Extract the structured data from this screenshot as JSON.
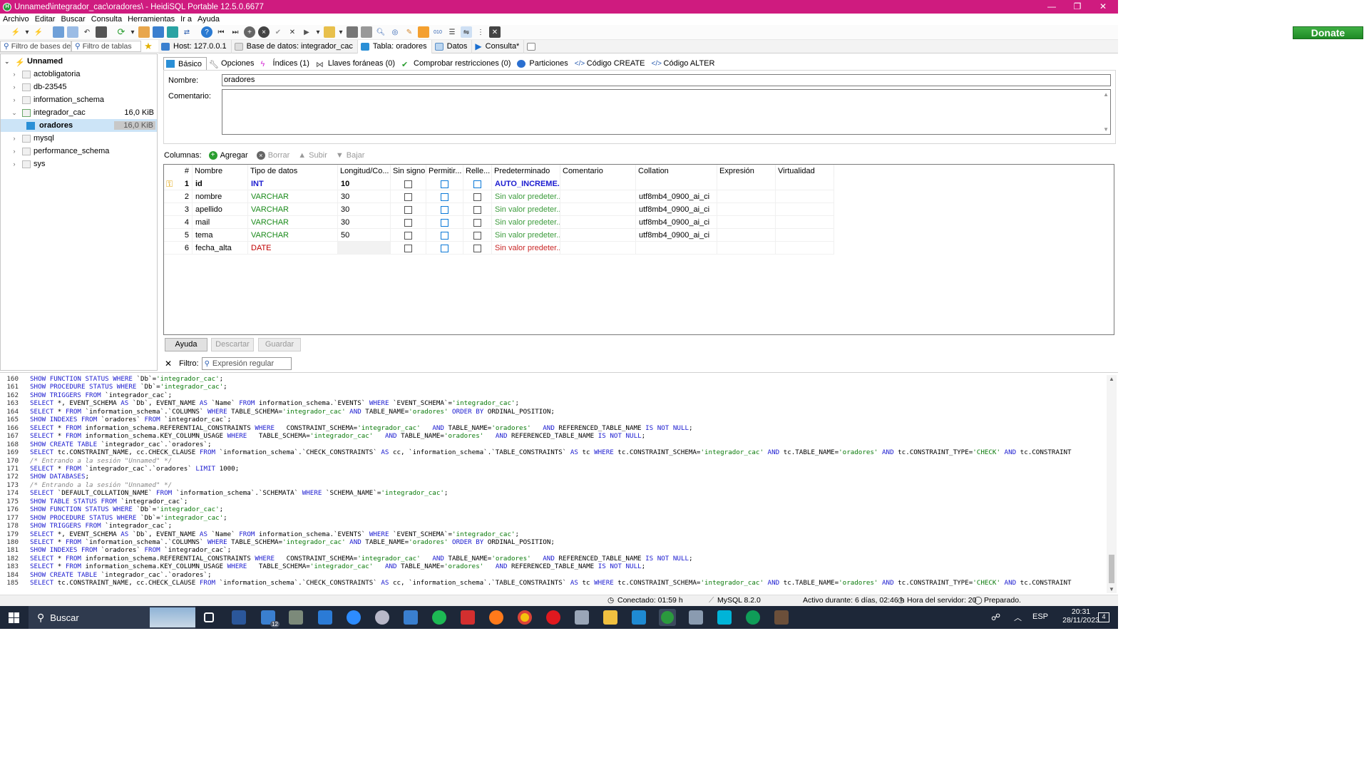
{
  "window": {
    "title": "Unnamed\\integrador_cac\\oradores\\ - HeidiSQL Portable 12.5.0.6677",
    "controls": [
      "—",
      "❐",
      "✕"
    ]
  },
  "menu": [
    "Archivo",
    "Editar",
    "Buscar",
    "Consulta",
    "Herramientas",
    "Ir a",
    "Ayuda"
  ],
  "donate_label": "Donate",
  "left_filters": {
    "db_placeholder": "Filtro de bases de c",
    "table_placeholder": "Filtro de tablas"
  },
  "top_tabs": [
    {
      "label": "Host: 127.0.0.1",
      "icon": "host-icon"
    },
    {
      "label": "Base de datos: integrador_cac",
      "icon": "database-icon"
    },
    {
      "label": "Tabla: oradores",
      "icon": "table-icon"
    },
    {
      "label": "Datos",
      "icon": "data-grid-icon"
    },
    {
      "label": "Consulta*",
      "icon": "play-icon"
    }
  ],
  "tree": {
    "root": "Unnamed",
    "items": [
      {
        "label": "actobligatoria",
        "size": ""
      },
      {
        "label": "db-23545",
        "size": ""
      },
      {
        "label": "information_schema",
        "size": ""
      },
      {
        "label": "integrador_cac",
        "size": "16,0 KiB"
      },
      {
        "label": "oradores",
        "size": "16,0 KiB"
      },
      {
        "label": "mysql",
        "size": ""
      },
      {
        "label": "performance_schema",
        "size": ""
      },
      {
        "label": "sys",
        "size": ""
      }
    ]
  },
  "sub_tabs": [
    "Básico",
    "Opciones",
    "Índices (1)",
    "Llaves foráneas (0)",
    "Comprobar restricciones (0)",
    "Particiones",
    "Código CREATE",
    "Código ALTER"
  ],
  "form": {
    "name_label": "Nombre:",
    "name_value": "oradores",
    "comment_label": "Comentario:",
    "comment_value": ""
  },
  "columns_bar": {
    "label": "Columnas:",
    "add": "Agregar",
    "delete": "Borrar",
    "up": "Subir",
    "down": "Bajar"
  },
  "grid": {
    "headers": [
      "#",
      "Nombre",
      "Tipo de datos",
      "Longitud/Co...",
      "Sin signo",
      "Permitir...",
      "Relle...",
      "Predeterminado",
      "Comentario",
      "Collation",
      "Expresión",
      "Virtualidad"
    ],
    "rows": [
      {
        "n": "1",
        "name": "id",
        "type": "INT",
        "len": "10",
        "unsigned": false,
        "nullable": false,
        "zerofill": false,
        "default": "AUTO_INCREME...",
        "comment": "",
        "collation": "",
        "type_color": "#1c1cd0",
        "primary": true
      },
      {
        "n": "2",
        "name": "nombre",
        "type": "VARCHAR",
        "len": "30",
        "unsigned": false,
        "nullable": false,
        "zerofill": false,
        "default": "Sin valor predeter...",
        "comment": "",
        "collation": "utf8mb4_0900_ai_ci",
        "type_color": "#1a8a1a",
        "primary": false
      },
      {
        "n": "3",
        "name": "apellido",
        "type": "VARCHAR",
        "len": "30",
        "unsigned": false,
        "nullable": false,
        "zerofill": false,
        "default": "Sin valor predeter...",
        "comment": "",
        "collation": "utf8mb4_0900_ai_ci",
        "type_color": "#1a8a1a",
        "primary": false
      },
      {
        "n": "4",
        "name": "mail",
        "type": "VARCHAR",
        "len": "30",
        "unsigned": false,
        "nullable": false,
        "zerofill": false,
        "default": "Sin valor predeter...",
        "comment": "",
        "collation": "utf8mb4_0900_ai_ci",
        "type_color": "#1a8a1a",
        "primary": false
      },
      {
        "n": "5",
        "name": "tema",
        "type": "VARCHAR",
        "len": "50",
        "unsigned": false,
        "nullable": false,
        "zerofill": false,
        "default": "Sin valor predeter...",
        "comment": "",
        "collation": "utf8mb4_0900_ai_ci",
        "type_color": "#1a8a1a",
        "primary": false
      },
      {
        "n": "6",
        "name": "fecha_alta",
        "type": "DATE",
        "len": "",
        "unsigned": false,
        "nullable": false,
        "zerofill": false,
        "default": "Sin valor predeter...",
        "comment": "",
        "collation": "",
        "type_color": "#c00000",
        "primary": false
      }
    ]
  },
  "buttons": {
    "help": "Ayuda",
    "discard": "Descartar",
    "save": "Guardar"
  },
  "filter": {
    "label": "Filtro:",
    "placeholder": "Expresión regular"
  },
  "sql_log": [
    {
      "n": "160",
      "t": "SHOW FUNCTION STATUS WHERE `Db`='integrador_cac';"
    },
    {
      "n": "161",
      "t": "SHOW PROCEDURE STATUS WHERE `Db`='integrador_cac';"
    },
    {
      "n": "162",
      "t": "SHOW TRIGGERS FROM `integrador_cac`;"
    },
    {
      "n": "163",
      "t": "SELECT *, EVENT_SCHEMA AS `Db`, EVENT_NAME AS `Name` FROM information_schema.`EVENTS` WHERE `EVENT_SCHEMA`='integrador_cac';"
    },
    {
      "n": "164",
      "t": "SELECT * FROM `information_schema`.`COLUMNS` WHERE TABLE_SCHEMA='integrador_cac' AND TABLE_NAME='oradores' ORDER BY ORDINAL_POSITION;"
    },
    {
      "n": "165",
      "t": "SHOW INDEXES FROM `oradores` FROM `integrador_cac`;"
    },
    {
      "n": "166",
      "t": "SELECT * FROM information_schema.REFERENTIAL_CONSTRAINTS WHERE   CONSTRAINT_SCHEMA='integrador_cac'   AND TABLE_NAME='oradores'   AND REFERENCED_TABLE_NAME IS NOT NULL;"
    },
    {
      "n": "167",
      "t": "SELECT * FROM information_schema.KEY_COLUMN_USAGE WHERE   TABLE_SCHEMA='integrador_cac'   AND TABLE_NAME='oradores'   AND REFERENCED_TABLE_NAME IS NOT NULL;"
    },
    {
      "n": "168",
      "t": "SHOW CREATE TABLE `integrador_cac`.`oradores`;"
    },
    {
      "n": "169",
      "t": "SELECT tc.CONSTRAINT_NAME, cc.CHECK_CLAUSE FROM `information_schema`.`CHECK_CONSTRAINTS` AS cc, `information_schema`.`TABLE_CONSTRAINTS` AS tc WHERE tc.CONSTRAINT_SCHEMA='integrador_cac' AND tc.TABLE_NAME='oradores' AND tc.CONSTRAINT_TYPE='CHECK' AND tc.CONSTRAINT"
    },
    {
      "n": "170",
      "t": "/* Entrando a la sesión \"Unnamed\" */"
    },
    {
      "n": "171",
      "t": "SELECT * FROM `integrador_cac`.`oradores` LIMIT 1000;"
    },
    {
      "n": "172",
      "t": "SHOW DATABASES;"
    },
    {
      "n": "173",
      "t": "/* Entrando a la sesión \"Unnamed\" */"
    },
    {
      "n": "174",
      "t": "SELECT `DEFAULT_COLLATION_NAME` FROM `information_schema`.`SCHEMATA` WHERE `SCHEMA_NAME`='integrador_cac';"
    },
    {
      "n": "175",
      "t": "SHOW TABLE STATUS FROM `integrador_cac`;"
    },
    {
      "n": "176",
      "t": "SHOW FUNCTION STATUS WHERE `Db`='integrador_cac';"
    },
    {
      "n": "177",
      "t": "SHOW PROCEDURE STATUS WHERE `Db`='integrador_cac';"
    },
    {
      "n": "178",
      "t": "SHOW TRIGGERS FROM `integrador_cac`;"
    },
    {
      "n": "179",
      "t": "SELECT *, EVENT_SCHEMA AS `Db`, EVENT_NAME AS `Name` FROM information_schema.`EVENTS` WHERE `EVENT_SCHEMA`='integrador_cac';"
    },
    {
      "n": "180",
      "t": "SELECT * FROM `information_schema`.`COLUMNS` WHERE TABLE_SCHEMA='integrador_cac' AND TABLE_NAME='oradores' ORDER BY ORDINAL_POSITION;"
    },
    {
      "n": "181",
      "t": "SHOW INDEXES FROM `oradores` FROM `integrador_cac`;"
    },
    {
      "n": "182",
      "t": "SELECT * FROM information_schema.REFERENTIAL_CONSTRAINTS WHERE   CONSTRAINT_SCHEMA='integrador_cac'   AND TABLE_NAME='oradores'   AND REFERENCED_TABLE_NAME IS NOT NULL;"
    },
    {
      "n": "183",
      "t": "SELECT * FROM information_schema.KEY_COLUMN_USAGE WHERE   TABLE_SCHEMA='integrador_cac'   AND TABLE_NAME='oradores'   AND REFERENCED_TABLE_NAME IS NOT NULL;"
    },
    {
      "n": "184",
      "t": "SHOW CREATE TABLE `integrador_cac`.`oradores`;"
    },
    {
      "n": "185",
      "t": "SELECT tc.CONSTRAINT_NAME, cc.CHECK_CLAUSE FROM `information_schema`.`CHECK_CONSTRAINTS` AS cc, `information_schema`.`TABLE_CONSTRAINTS` AS tc WHERE tc.CONSTRAINT_SCHEMA='integrador_cac' AND tc.TABLE_NAME='oradores' AND tc.CONSTRAINT_TYPE='CHECK' AND tc.CONSTRAINT"
    }
  ],
  "status": {
    "connected": "Conectado: 01:59 h",
    "server": "MySQL 8.2.0",
    "uptime": "Activo durante: 6 días, 02:46 h",
    "server_time": "Hora del servidor: 20",
    "state": "Preparado."
  },
  "taskbar": {
    "search": "Buscar",
    "lang": "ESP",
    "time": "20:31",
    "date": "28/11/2023",
    "notif": "4",
    "mail_badge": "12"
  },
  "colors": {
    "titlebar": "#cf1b7f",
    "donate": "#2a9e30",
    "accent": "#0a78d7"
  }
}
